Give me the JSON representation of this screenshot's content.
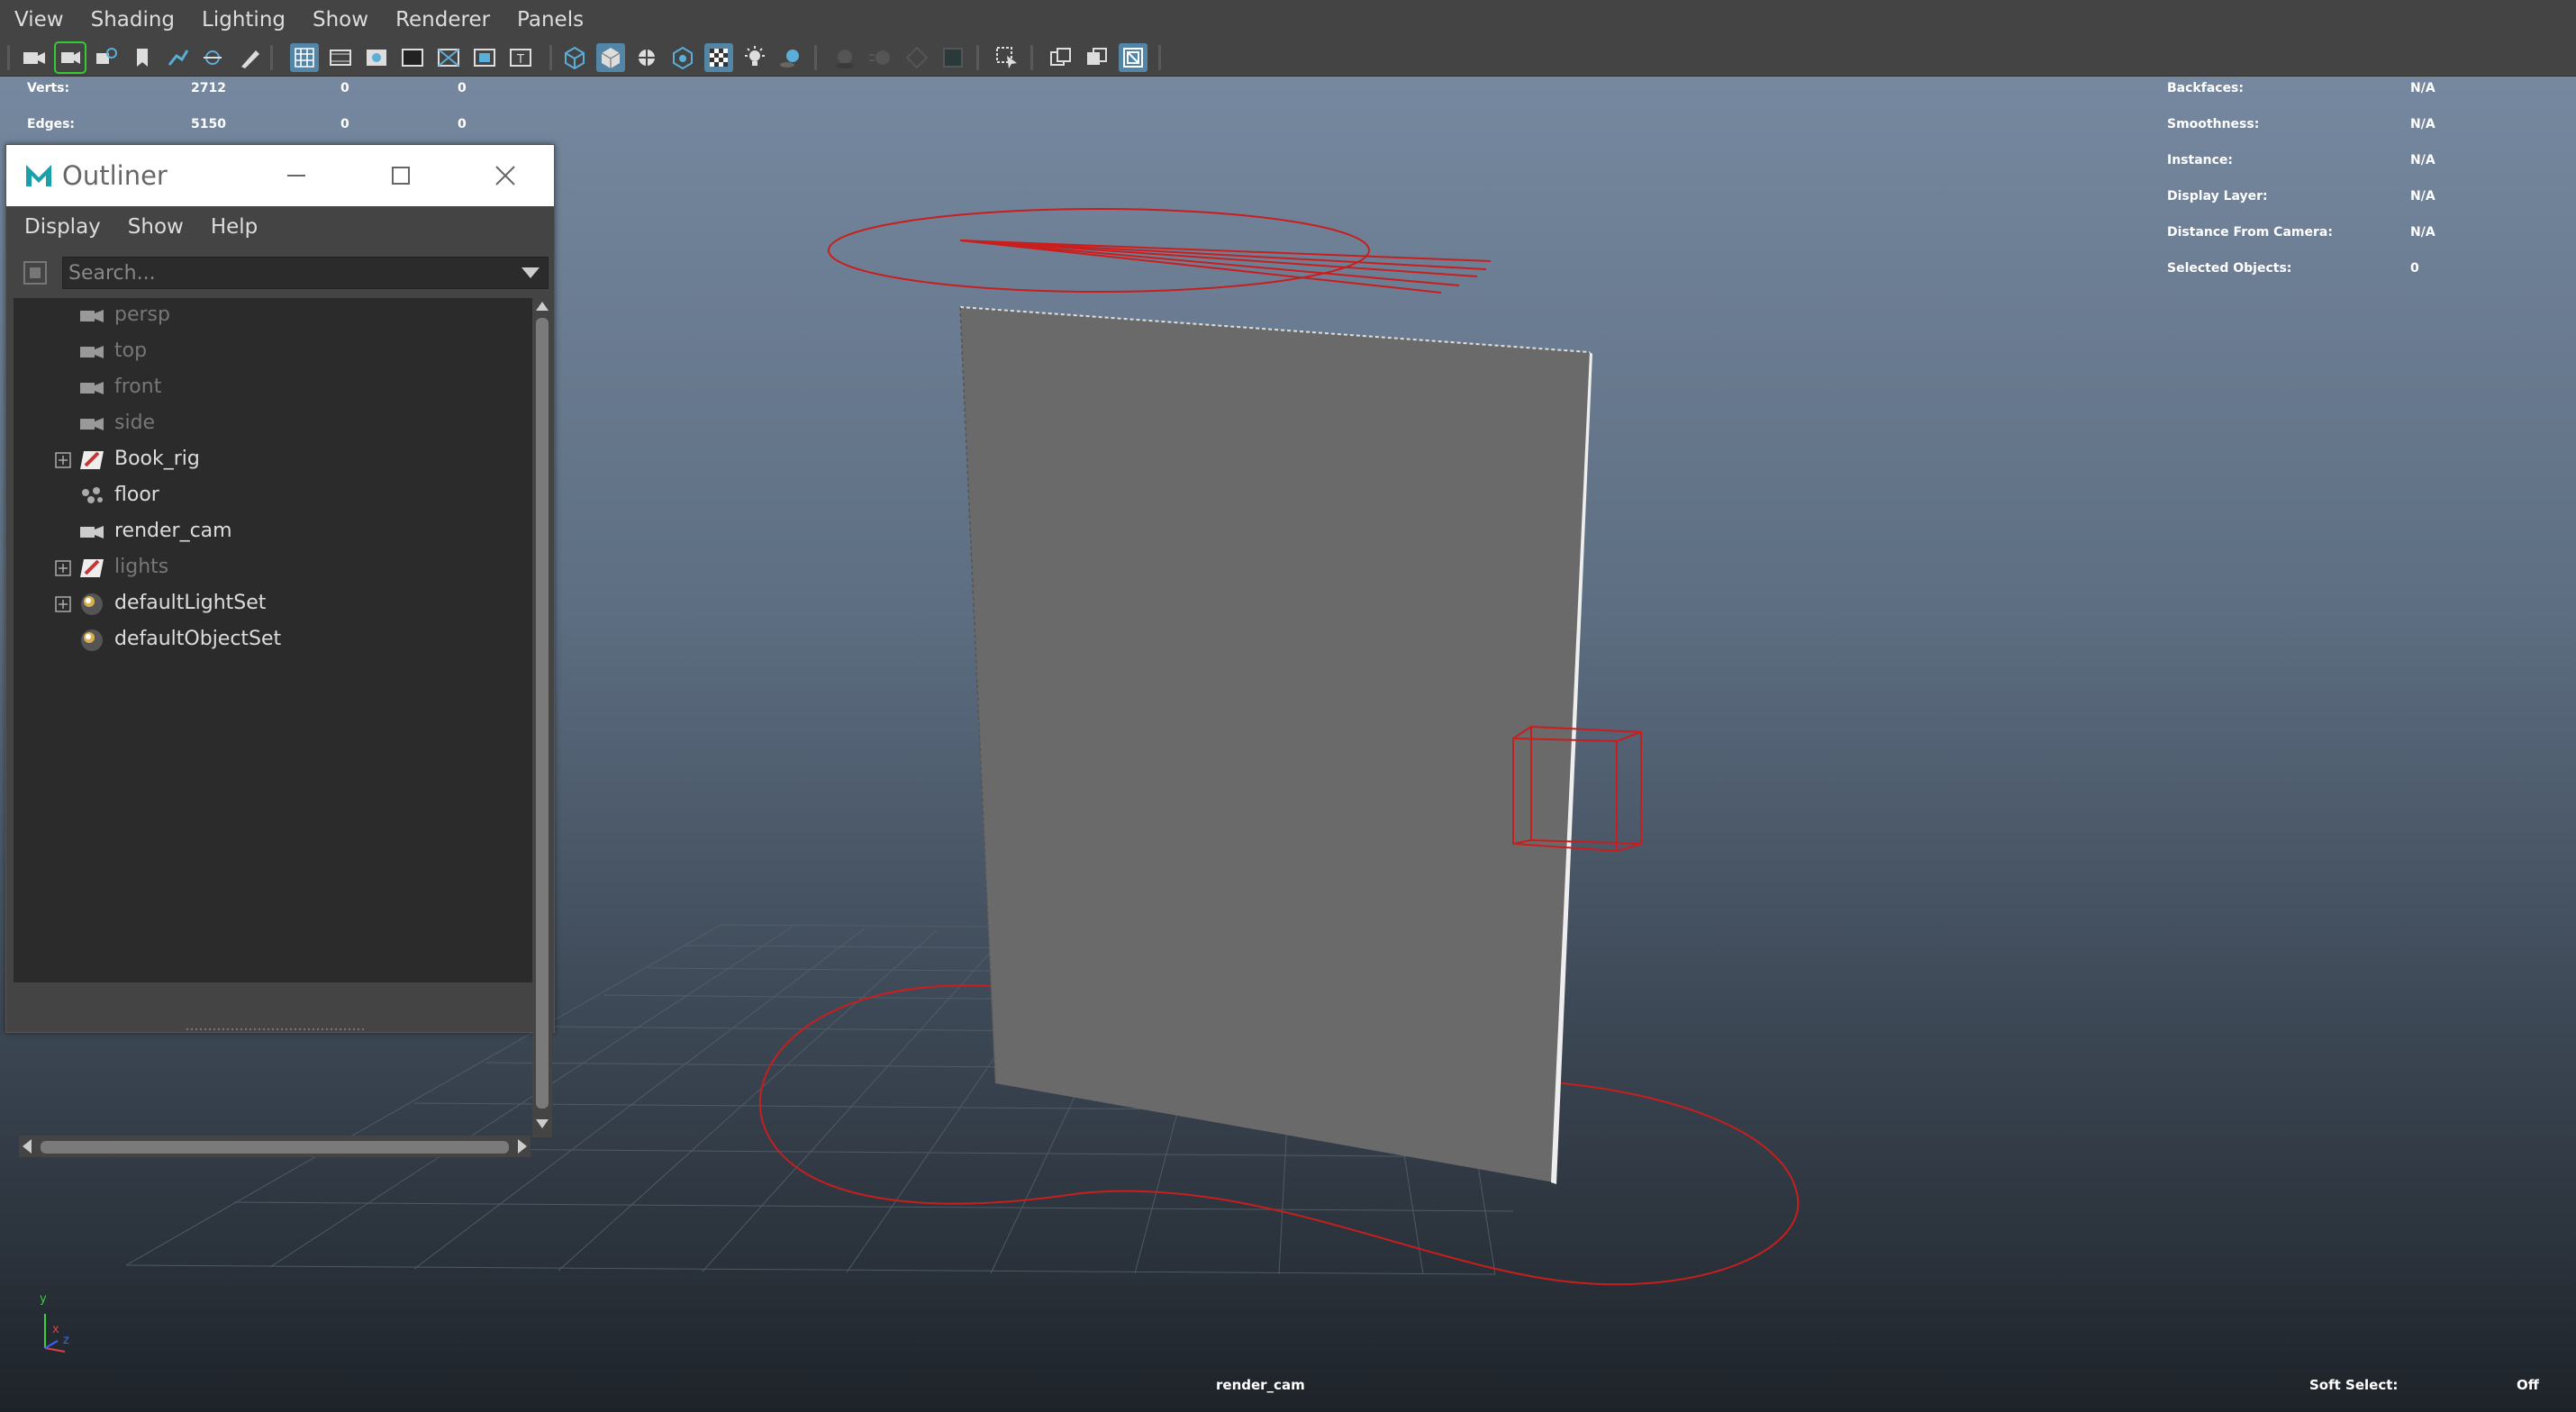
{
  "menubar": {
    "items": [
      "View",
      "Shading",
      "Lighting",
      "Show",
      "Renderer",
      "Panels"
    ]
  },
  "toolbar": {
    "icons": [
      "select-camera-icon",
      "camera-attributes-icon",
      "bookmark-icon",
      "image-plane-icon",
      "2d-pan-zoom-icon",
      "grease-pencil-icon",
      "grid-icon",
      "film-gate-icon",
      "resolution-gate-icon",
      "gate-mask-icon",
      "field-chart-icon",
      "safe-action-icon",
      "safe-title-icon",
      "wireframe-icon",
      "smooth-shade-icon",
      "wireframe-on-shaded-icon",
      "xray-icon",
      "textured-icon",
      "lights-icon",
      "shadows-icon",
      "ambient-occlusion-icon",
      "motion-blur-icon",
      "antialiasing-icon",
      "depth-of-field-icon",
      "isolate-select-icon",
      "xray-joints-icon",
      "xray-active-icon",
      "backface-culling-icon"
    ]
  },
  "hud_left": {
    "rows": [
      {
        "label": "Verts:",
        "v1": "2712",
        "v2": "0",
        "v3": "0"
      },
      {
        "label": "Edges:",
        "v1": "5150",
        "v2": "0",
        "v3": "0"
      }
    ]
  },
  "hud_right": {
    "rows": [
      {
        "label": "Backfaces:",
        "value": "N/A"
      },
      {
        "label": "Smoothness:",
        "value": "N/A"
      },
      {
        "label": "Instance:",
        "value": "N/A"
      },
      {
        "label": "Display Layer:",
        "value": "N/A"
      },
      {
        "label": "Distance From Camera:",
        "value": "N/A"
      },
      {
        "label": "Selected Objects:",
        "value": "0"
      }
    ]
  },
  "outliner": {
    "title": "Outliner",
    "menu": [
      "Display",
      "Show",
      "Help"
    ],
    "search_placeholder": "Search...",
    "items": [
      {
        "label": "persp",
        "icon": "camera-icon",
        "expandable": false,
        "dimmed": true
      },
      {
        "label": "top",
        "icon": "camera-icon",
        "expandable": false,
        "dimmed": true
      },
      {
        "label": "front",
        "icon": "camera-icon",
        "expandable": false,
        "dimmed": true
      },
      {
        "label": "side",
        "icon": "camera-icon",
        "expandable": false,
        "dimmed": true
      },
      {
        "label": "Book_rig",
        "icon": "group-icon",
        "expandable": true,
        "dimmed": false
      },
      {
        "label": "floor",
        "icon": "mesh-icon",
        "expandable": false,
        "dimmed": false
      },
      {
        "label": "render_cam",
        "icon": "camera-icon",
        "expandable": false,
        "dimmed": false
      },
      {
        "label": "lights",
        "icon": "group-icon",
        "expandable": true,
        "dimmed": true
      },
      {
        "label": "defaultLightSet",
        "icon": "set-icon",
        "expandable": true,
        "dimmed": false
      },
      {
        "label": "defaultObjectSet",
        "icon": "set-icon",
        "expandable": false,
        "dimmed": false
      }
    ]
  },
  "viewport": {
    "camera_label": "render_cam",
    "soft_select_label": "Soft Select:",
    "soft_select_value": "Off",
    "axis_labels": [
      "y",
      "x",
      "z"
    ]
  },
  "colors": {
    "accent": "#5285a6",
    "curve_red": "#c81e1e",
    "plane_gray": "#6a6a6a"
  }
}
